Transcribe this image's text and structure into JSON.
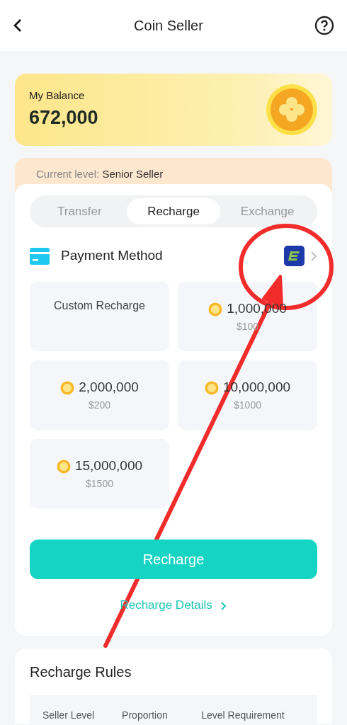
{
  "header": {
    "title": "Coin Seller"
  },
  "balance": {
    "label": "My Balance",
    "amount": "672,000"
  },
  "level": {
    "label": "Current level:",
    "value": "Senior Seller"
  },
  "tabs": [
    {
      "label": "Transfer",
      "selected": false
    },
    {
      "label": "Recharge",
      "selected": true
    },
    {
      "label": "Exchange",
      "selected": false
    }
  ],
  "payment": {
    "label": "Payment Method"
  },
  "packages": [
    {
      "kind": "custom",
      "label": "Custom Recharge"
    },
    {
      "kind": "coins",
      "coins": "1,000,000",
      "price": "$100"
    },
    {
      "kind": "coins",
      "coins": "2,000,000",
      "price": "$200"
    },
    {
      "kind": "coins",
      "coins": "10,000,000",
      "price": "$1000"
    },
    {
      "kind": "coins",
      "coins": "15,000,000",
      "price": "$1500"
    }
  ],
  "recharge_button": "Recharge",
  "details_link": "Recharge Details",
  "rules": {
    "title": "Recharge Rules",
    "columns": [
      "Seller Level",
      "Proportion",
      "Level Requirement"
    ]
  }
}
